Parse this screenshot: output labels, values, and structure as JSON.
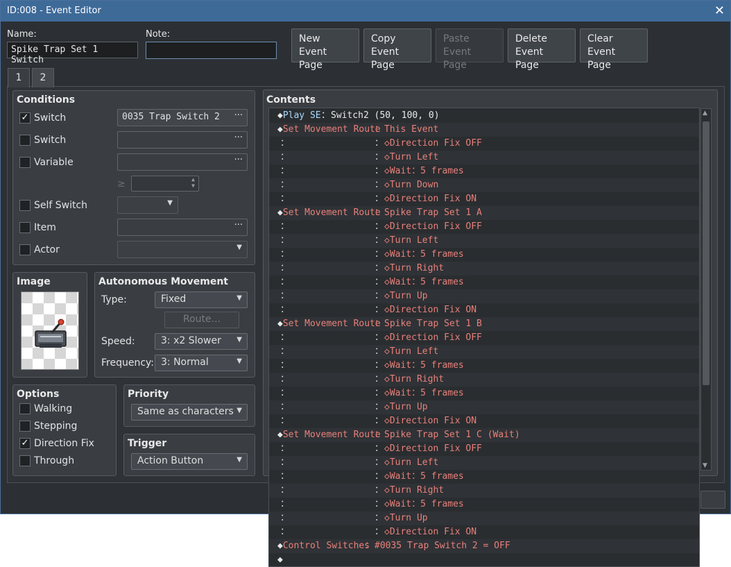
{
  "window": {
    "title": "ID:008 - Event Editor"
  },
  "header": {
    "name_label": "Name:",
    "name_value": "Spike Trap Set 1 Switch",
    "note_label": "Note:",
    "note_value": "",
    "buttons": [
      {
        "line1": "New",
        "line2": "Event Page"
      },
      {
        "line1": "Copy",
        "line2": "Event Page"
      },
      {
        "line1": "Paste",
        "line2": "Event Page"
      },
      {
        "line1": "Delete",
        "line2": "Event Page"
      },
      {
        "line1": "Clear",
        "line2": "Event Page"
      }
    ]
  },
  "tabs": [
    "1",
    "2"
  ],
  "conditions": {
    "title": "Conditions",
    "switch1_label": "Switch",
    "switch1_value": "0035 Trap Switch 2",
    "switch2_label": "Switch",
    "variable_label": "Variable",
    "gte": "≥",
    "self_switch_label": "Self Switch",
    "item_label": "Item",
    "actor_label": "Actor",
    "dots": "···"
  },
  "image": {
    "title": "Image"
  },
  "autonomous": {
    "title": "Autonomous Movement",
    "type_label": "Type:",
    "type_value": "Fixed",
    "route_button": "Route...",
    "speed_label": "Speed:",
    "speed_value": "3: x2 Slower",
    "frequency_label": "Frequency:",
    "frequency_value": "3: Normal"
  },
  "options": {
    "title": "Options",
    "walking": "Walking",
    "stepping": "Stepping",
    "direction_fix": "Direction Fix",
    "through": "Through"
  },
  "priority": {
    "title": "Priority",
    "value": "Same as characters"
  },
  "trigger": {
    "title": "Trigger",
    "value": "Action Button"
  },
  "contents": {
    "title": "Contents",
    "rows": [
      {
        "a": "◆Play SE",
        "sep": "：",
        "b": "Switch2 (50, 100, 0)",
        "kind": "se"
      },
      {
        "a": "◆Set Movement Route",
        "sep": "：",
        "b": "This Event",
        "kind": "head"
      },
      {
        "a": "：",
        "sep": "：",
        "b": "◇Direction Fix OFF",
        "kind": "sub"
      },
      {
        "a": "：",
        "sep": "：",
        "b": "◇Turn Left",
        "kind": "sub"
      },
      {
        "a": "：",
        "sep": "：",
        "b": "◇Wait：5 frames",
        "kind": "sub"
      },
      {
        "a": "：",
        "sep": "：",
        "b": "◇Turn Down",
        "kind": "sub"
      },
      {
        "a": "：",
        "sep": "：",
        "b": "◇Direction Fix ON",
        "kind": "sub"
      },
      {
        "a": "◆Set Movement Route",
        "sep": "：",
        "b": "Spike Trap Set 1 A",
        "kind": "head"
      },
      {
        "a": "：",
        "sep": "：",
        "b": "◇Direction Fix OFF",
        "kind": "sub"
      },
      {
        "a": "：",
        "sep": "：",
        "b": "◇Turn Left",
        "kind": "sub"
      },
      {
        "a": "：",
        "sep": "：",
        "b": "◇Wait：5 frames",
        "kind": "sub"
      },
      {
        "a": "：",
        "sep": "：",
        "b": "◇Turn Right",
        "kind": "sub"
      },
      {
        "a": "：",
        "sep": "：",
        "b": "◇Wait：5 frames",
        "kind": "sub"
      },
      {
        "a": "：",
        "sep": "：",
        "b": "◇Turn Up",
        "kind": "sub"
      },
      {
        "a": "：",
        "sep": "：",
        "b": "◇Direction Fix ON",
        "kind": "sub"
      },
      {
        "a": "◆Set Movement Route",
        "sep": "：",
        "b": "Spike Trap Set 1 B",
        "kind": "head"
      },
      {
        "a": "：",
        "sep": "：",
        "b": "◇Direction Fix OFF",
        "kind": "sub"
      },
      {
        "a": "：",
        "sep": "：",
        "b": "◇Turn Left",
        "kind": "sub"
      },
      {
        "a": "：",
        "sep": "：",
        "b": "◇Wait：5 frames",
        "kind": "sub"
      },
      {
        "a": "：",
        "sep": "：",
        "b": "◇Turn Right",
        "kind": "sub"
      },
      {
        "a": "：",
        "sep": "：",
        "b": "◇Wait：5 frames",
        "kind": "sub"
      },
      {
        "a": "：",
        "sep": "：",
        "b": "◇Turn Up",
        "kind": "sub"
      },
      {
        "a": "：",
        "sep": "：",
        "b": "◇Direction Fix ON",
        "kind": "sub"
      },
      {
        "a": "◆Set Movement Route",
        "sep": "：",
        "b": "Spike Trap Set 1 C (Wait)",
        "kind": "head"
      },
      {
        "a": "：",
        "sep": "：",
        "b": "◇Direction Fix OFF",
        "kind": "sub"
      },
      {
        "a": "：",
        "sep": "：",
        "b": "◇Turn Left",
        "kind": "sub"
      },
      {
        "a": "：",
        "sep": "：",
        "b": "◇Wait：5 frames",
        "kind": "sub"
      },
      {
        "a": "：",
        "sep": "：",
        "b": "◇Turn Right",
        "kind": "sub"
      },
      {
        "a": "：",
        "sep": "：",
        "b": "◇Wait：5 frames",
        "kind": "sub"
      },
      {
        "a": "：",
        "sep": "：",
        "b": "◇Turn Up",
        "kind": "sub"
      },
      {
        "a": "：",
        "sep": "：",
        "b": "◇Direction Fix ON",
        "kind": "sub"
      },
      {
        "a": "◆Control Switches",
        "sep": "：",
        "b": "#0035 Trap Switch 2 = OFF",
        "kind": "ctrl"
      },
      {
        "a": "◆",
        "sep": "",
        "b": "",
        "kind": "end"
      }
    ]
  },
  "colors": {
    "title_bar": "#3e6a98",
    "command_red": "#e8807a",
    "command_white": "#e8e8e8",
    "switch_cyan": "#a8d8ff"
  }
}
